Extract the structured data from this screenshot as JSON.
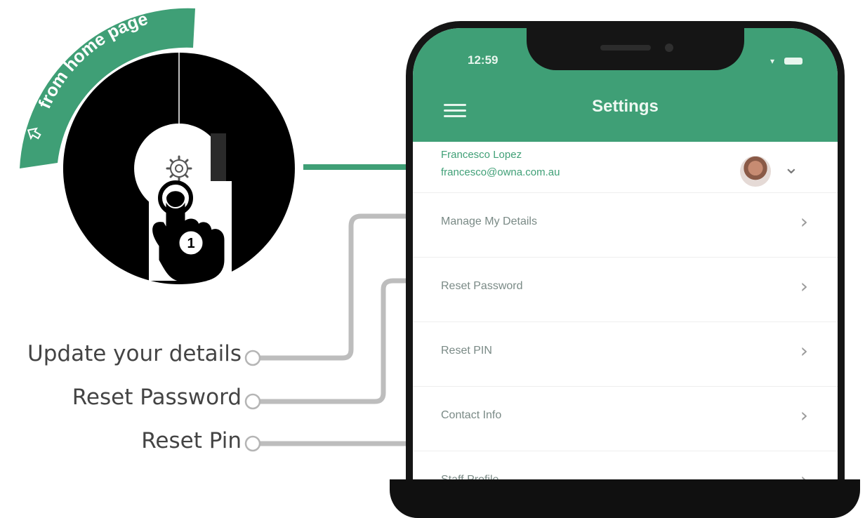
{
  "badge": {
    "text": "from home page",
    "icon": "arrow-up-icon"
  },
  "step": {
    "number": "1",
    "icon": "gear-icon",
    "hand_icon": "tap-hand-icon"
  },
  "phone": {
    "time": "12:59",
    "title": "Settings",
    "profile": {
      "name": "Francesco Lopez",
      "email": "francesco@owna.com.au"
    },
    "menu": [
      {
        "label": "Manage My Details"
      },
      {
        "label": "Reset Password"
      },
      {
        "label": "Reset PIN"
      },
      {
        "label": "Contact Info"
      },
      {
        "label": "Staff Profile"
      }
    ]
  },
  "callouts": [
    {
      "label": "Update your details"
    },
    {
      "label": "Reset Password"
    },
    {
      "label": "Reset Pin"
    }
  ],
  "colors": {
    "accent": "#3f9f76",
    "connector": "#bdbdbd",
    "label_text": "#444444"
  }
}
